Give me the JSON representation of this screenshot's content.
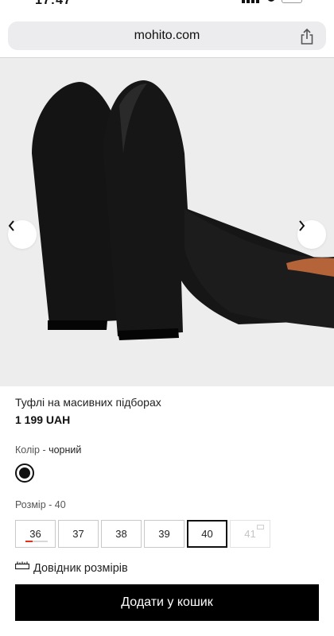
{
  "status_bar": {
    "time": "17:47"
  },
  "browser": {
    "url": "mohito.com",
    "share_icon": "share-icon"
  },
  "gallery": {
    "prev_icon": "chevron-left-icon",
    "next_icon": "chevron-right-icon"
  },
  "product": {
    "title": "Туфлі на масивних підборах",
    "price": "1 199 UAH"
  },
  "color": {
    "label": "Колір",
    "separator": " - ",
    "value": "чорний",
    "swatch_color": "#111111"
  },
  "size": {
    "label": "Розмір - 40",
    "options": [
      {
        "label": "36",
        "state": "low-stock"
      },
      {
        "label": "37",
        "state": "available"
      },
      {
        "label": "38",
        "state": "available"
      },
      {
        "label": "39",
        "state": "available"
      },
      {
        "label": "40",
        "state": "selected"
      },
      {
        "label": "41",
        "state": "unavailable"
      }
    ],
    "guide_label": "Довідник розмірів"
  },
  "cart": {
    "add_label": "Додати у кошик"
  },
  "colors": {
    "button_bg": "#000000",
    "low_stock": "#e0311c",
    "image_bg": "#ededed"
  }
}
